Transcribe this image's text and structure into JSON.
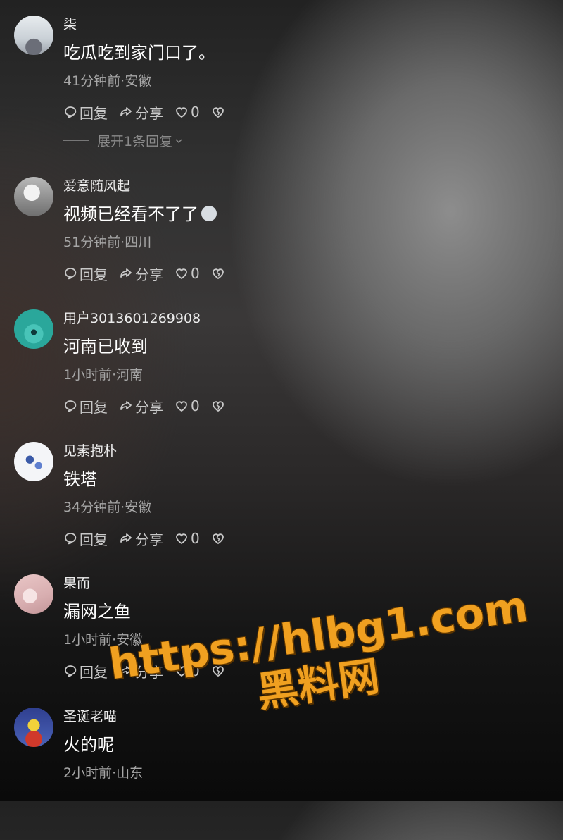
{
  "labels": {
    "reply": "回复",
    "share": "分享",
    "like_count": "0"
  },
  "comments": [
    {
      "username": "柒",
      "text": "吃瓜吃到家门口了。",
      "meta": "41分钟前·安徽",
      "expand": "展开1条回复"
    },
    {
      "username": "爱意随风起",
      "text": "视频已经看不了了",
      "meta": "51分钟前·四川"
    },
    {
      "username": "用户3013601269908",
      "text": "河南已收到",
      "meta": "1小时前·河南"
    },
    {
      "username": "见素抱朴",
      "text": "铁塔",
      "meta": "34分钟前·安徽"
    },
    {
      "username": "果而",
      "text": "漏网之鱼",
      "meta": "1小时前·安徽"
    },
    {
      "username": "圣诞老喵",
      "text": "火的呢",
      "meta": "2小时前·山东"
    }
  ],
  "watermark": {
    "url": "https://hlbg1.com",
    "name": "黑料网"
  },
  "colors": {
    "watermark": "#f0a020",
    "meta_text": "#a6a6a6",
    "action_text": "#c8c8c8"
  }
}
